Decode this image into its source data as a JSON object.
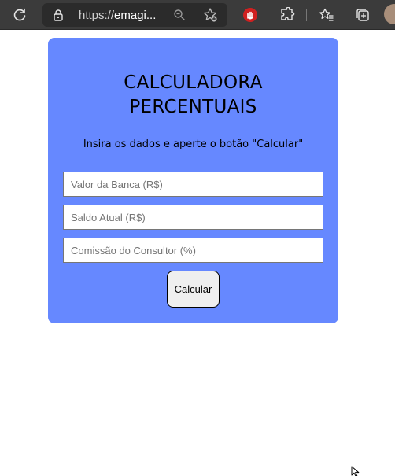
{
  "browser": {
    "url_scheme": "https://",
    "url_host": "emagi...",
    "icons": [
      "reload-icon",
      "lock-icon",
      "zoom-icon",
      "add-favorite-icon",
      "extension-hand-icon",
      "extensions-icon",
      "favorites-icon",
      "collections-icon",
      "profile-avatar"
    ]
  },
  "calculator": {
    "title_line1": "CALCULADORA",
    "title_line2": "PERCENTUAIS",
    "subtitle": "Insira os dados e aperte o botão \"Calcular\"",
    "fields": [
      {
        "placeholder": "Valor da Banca (R$)",
        "value": ""
      },
      {
        "placeholder": "Saldo Atual (R$)",
        "value": ""
      },
      {
        "placeholder": "Comissão do Consultor (%)",
        "value": ""
      }
    ],
    "button_label": "Calcular",
    "colors": {
      "card_background": "#6688ff",
      "page_background": "#ffffff"
    }
  }
}
